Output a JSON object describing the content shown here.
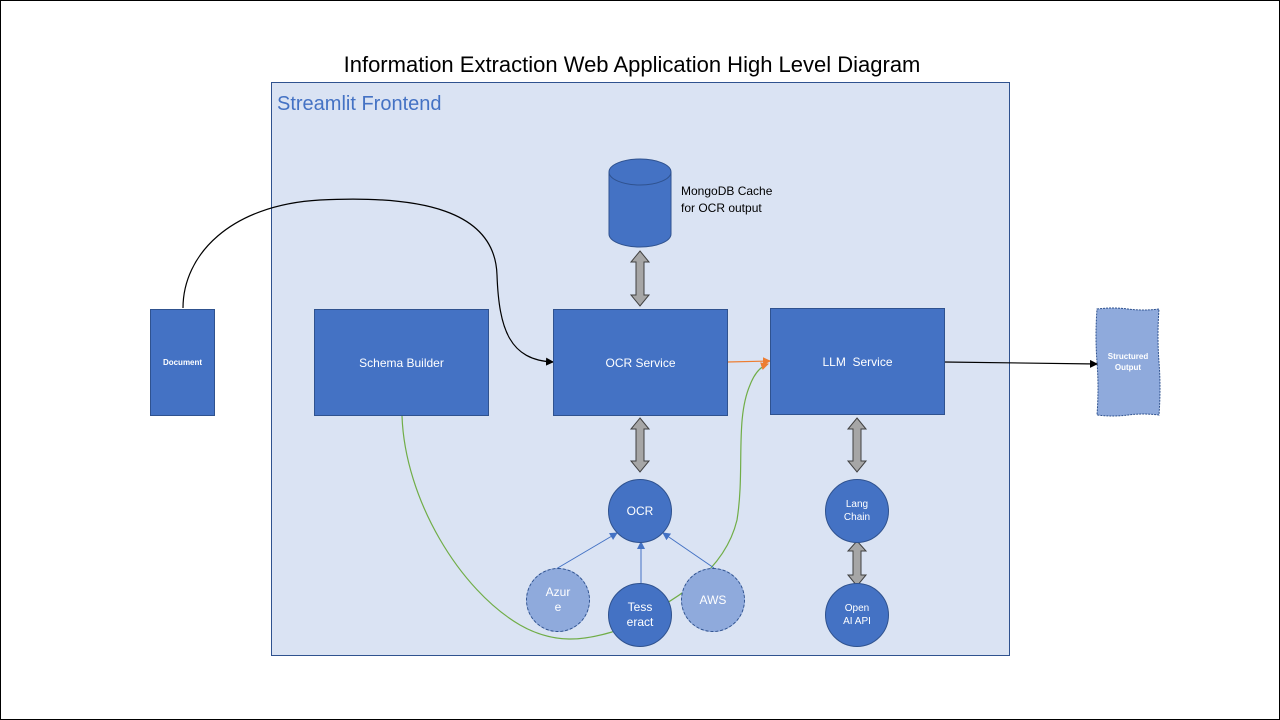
{
  "title": "Information Extraction Web Application High Level Diagram",
  "frontend": {
    "label": "Streamlit Frontend"
  },
  "nodes": {
    "document": "Document",
    "schema_builder": "Schema Builder",
    "ocr_service": "OCR Service",
    "llm_service": "LLM  Service",
    "mongodb_cache": "MongoDB Cache\nfor OCR output",
    "structured_output": "Structured\nOutput",
    "ocr": "OCR",
    "azure": "Azur\ne",
    "tesseract": "Tess\neract",
    "aws": "AWS",
    "langchain": "Lang\nChain",
    "openai_api": "Open\nAI API"
  },
  "colors": {
    "node_fill": "#4472c4",
    "node_border": "#2f528f",
    "light_node_fill": "#8faadc",
    "frontend_fill": "#dae3f3",
    "frontend_text": "#4472c4",
    "double_arrow_fill": "#a6a6a6",
    "ocr_to_llm_arrow": "#ed7d31",
    "schema_curve": "#70ad47",
    "provider_arrows": "#4472c4"
  }
}
